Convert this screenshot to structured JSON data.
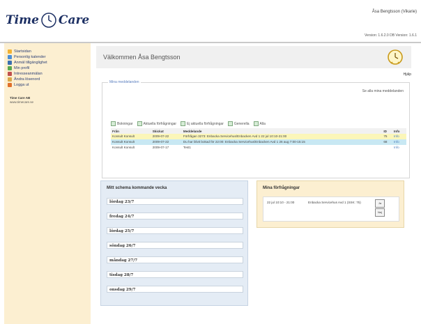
{
  "app": {
    "logo_word1": "Time",
    "logo_word2": "Care",
    "user_name": "Åsa Bengtsson (Vikarie)",
    "version": "Version: 1.6.2.0   DB Version: 1.6.1"
  },
  "sidebar": {
    "items": [
      {
        "label": "Startsidan",
        "icon": "home-icon",
        "color": "#f2b233"
      },
      {
        "label": "Personlig kalender",
        "icon": "calendar-icon",
        "color": "#4c8fd6"
      },
      {
        "label": "Anmäl tillgänglighet",
        "icon": "availability-icon",
        "color": "#3a6fb0"
      },
      {
        "label": "Min profil",
        "icon": "profile-icon",
        "color": "#5aa84f"
      },
      {
        "label": "Intresseanmälan",
        "icon": "interest-icon",
        "color": "#c0504d"
      },
      {
        "label": "Ändra lösenord",
        "icon": "key-icon",
        "color": "#d9a84a"
      },
      {
        "label": "Logga ut",
        "icon": "logout-icon",
        "color": "#e0702a"
      }
    ],
    "company_name": "Time Care AB",
    "company_url": "www.timecare.se"
  },
  "main": {
    "welcome": "Välkommen Åsa Bengtsson",
    "help": "Hjälp"
  },
  "messages": {
    "legend": "Mina meddelanden",
    "see_all": "Se alla mina meddelanden",
    "filters": [
      "Bokningar",
      "Aktuella förfrågningar",
      "Ej aktuella förfrågningar",
      "Generella",
      "Alla"
    ],
    "columns": [
      "Från",
      "Skickat",
      "Meddelande",
      "ID",
      "Info"
    ],
    "rows": [
      {
        "from": "Konsult Konsult",
        "sent": "2009-07-22",
        "message": "Förfrågan 3273: Enbacka Servicehus/Enbacken Avd 1 22 jul 10:10-21:00",
        "id": "75",
        "info": "Info"
      },
      {
        "from": "Konsult Konsult",
        "sent": "2009-07-22",
        "message": "Du har blivit bokad för 22:00: Enbacka Servicehus/Enbacken Avd 1 26 aug 7:00-15:15",
        "id": "68",
        "info": "Info"
      },
      {
        "from": "Konsult Konsult",
        "sent": "2009-07-17",
        "message": "Test1",
        "id": "",
        "info": "Info"
      }
    ]
  },
  "schedule": {
    "title": "Mitt schema kommande vecka",
    "days": [
      "lördag 23/7",
      "fredag 24/7",
      "lördag 25/7",
      "söndag 26/7",
      "måndag 27/7",
      "tisdag 28/7",
      "onsdag 29/7"
    ]
  },
  "requests": {
    "title": "Mina förfrågningar",
    "date": "22 jul 10:10 - 21:00",
    "text": "Enbacka Servicehus Avd 1 (SSK: 75)",
    "yes_label": "Ja",
    "no_label": "Nej"
  }
}
